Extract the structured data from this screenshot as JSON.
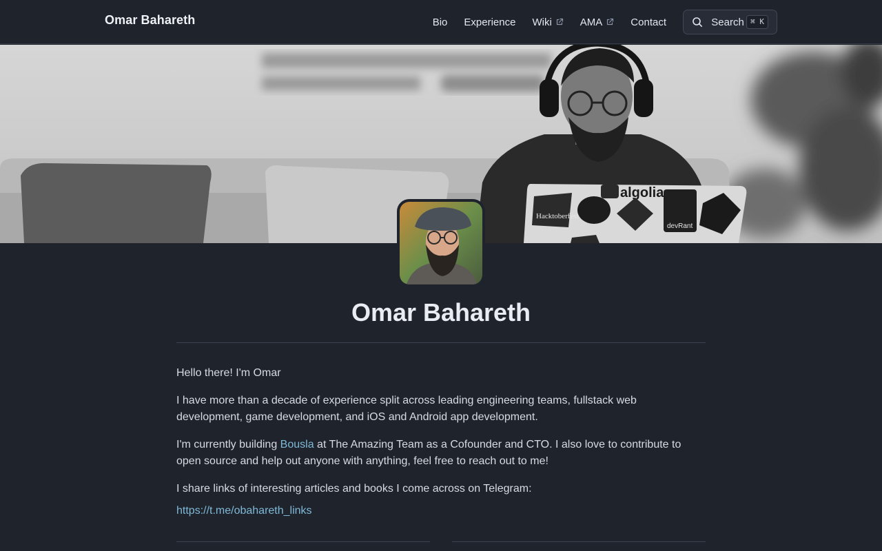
{
  "header": {
    "brand": "Omar Bahareth",
    "nav": [
      {
        "label": "Bio",
        "external": false
      },
      {
        "label": "Experience",
        "external": false
      },
      {
        "label": "Wiki",
        "external": true
      },
      {
        "label": "AMA",
        "external": true
      },
      {
        "label": "Contact",
        "external": false
      }
    ],
    "search": {
      "label": "Search",
      "shortcut": "⌘ K"
    }
  },
  "hero": {
    "sticker_text": "algolia",
    "sticker_text_2": "devRant",
    "sticker_text_3": "Hacktoberfest"
  },
  "profile": {
    "name": "Omar Bahareth"
  },
  "bio": {
    "greeting": "Hello there! I'm Omar",
    "experience": "I have more than a decade of experience split across leading engineering teams, fullstack web development, game development, and iOS and Android app development.",
    "current_before": "I'm currently building ",
    "current_link": "Bousla",
    "current_after": " at The Amazing Team as a Cofounder and CTO. I also love to contribute to open source and help out anyone with anything, feel free to reach out to me!",
    "share": "I share links of interesting articles and books I come across on Telegram:",
    "telegram_link": "https://t.me/obahareth_links"
  },
  "colors": {
    "background": "#1f232c",
    "accent_link": "#7fb9d8",
    "heading": "#e9ecf2"
  },
  "icons": {
    "external": "external-link-icon",
    "search": "search-icon"
  }
}
